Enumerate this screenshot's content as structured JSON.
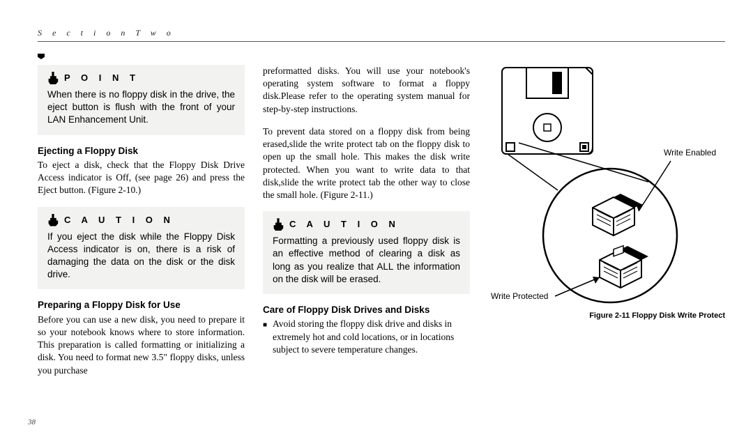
{
  "header": {
    "section_label": "S e c t i o n   T w o"
  },
  "page_number": "38",
  "col1": {
    "point": {
      "title": "P O I N T",
      "body": "When there is no floppy disk in the drive, the eject button is flush with the front of your LAN Enhancement Unit."
    },
    "ejecting": {
      "head": "Ejecting a Floppy Disk",
      "body": "To eject a disk, check that the Floppy Disk Drive Access indicator is Off, (see page 26) and press the Eject button. (Figure 2-10.)"
    },
    "caution": {
      "title": "C A U T I O N",
      "body": "If you eject the disk while the Floppy Disk Access indicator is on, there is a risk of damaging the data on the disk or the disk drive."
    },
    "preparing": {
      "head": "Preparing a Floppy Disk for Use",
      "body": "Before you can use a new disk, you need to prepare it so your notebook knows where to store information. This preparation is called formatting or initializing a disk. You need to format new 3.5\" floppy disks, unless you purchase"
    }
  },
  "col2": {
    "para1": "preformatted disks. You will use your notebook's operating system software to format a floppy disk.Please  refer to the operating system manual for step-by-step instructions.",
    "para2": "To prevent data stored on a floppy disk from being erased,slide  the write protect tab on the floppy disk to open up the small hole. This makes the disk write protected. When you want to write data to that disk,slide the write protect tab the other way to close the small hole. (Figure 2-11.)",
    "caution": {
      "title": "C A U T I O N",
      "body": "Formatting a previously used floppy disk is an effective method of clearing a disk as long as you realize that ALL the information on the disk will be erased."
    },
    "care": {
      "head": "Care of Floppy Disk Drives and Disks",
      "bullet": "Avoid storing the floppy disk drive and disks in extremely hot and cold locations, or in locations subject to severe temperature changes."
    }
  },
  "figure": {
    "label_enabled": "Write Enabled",
    "label_protected": "Write Protected",
    "caption": "Figure 2-11 Floppy Disk Write Protect"
  }
}
